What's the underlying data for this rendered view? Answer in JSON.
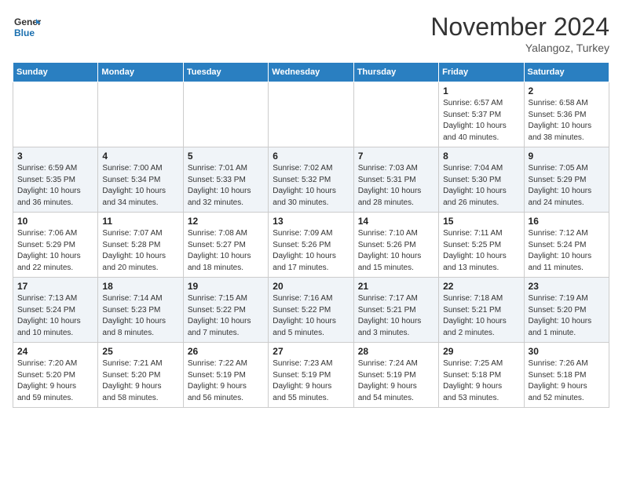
{
  "header": {
    "logo_line1": "General",
    "logo_line2": "Blue",
    "month": "November 2024",
    "location": "Yalangoz, Turkey"
  },
  "weekdays": [
    "Sunday",
    "Monday",
    "Tuesday",
    "Wednesday",
    "Thursday",
    "Friday",
    "Saturday"
  ],
  "weeks": [
    [
      {
        "day": "",
        "info": ""
      },
      {
        "day": "",
        "info": ""
      },
      {
        "day": "",
        "info": ""
      },
      {
        "day": "",
        "info": ""
      },
      {
        "day": "",
        "info": ""
      },
      {
        "day": "1",
        "info": "Sunrise: 6:57 AM\nSunset: 5:37 PM\nDaylight: 10 hours\nand 40 minutes."
      },
      {
        "day": "2",
        "info": "Sunrise: 6:58 AM\nSunset: 5:36 PM\nDaylight: 10 hours\nand 38 minutes."
      }
    ],
    [
      {
        "day": "3",
        "info": "Sunrise: 6:59 AM\nSunset: 5:35 PM\nDaylight: 10 hours\nand 36 minutes."
      },
      {
        "day": "4",
        "info": "Sunrise: 7:00 AM\nSunset: 5:34 PM\nDaylight: 10 hours\nand 34 minutes."
      },
      {
        "day": "5",
        "info": "Sunrise: 7:01 AM\nSunset: 5:33 PM\nDaylight: 10 hours\nand 32 minutes."
      },
      {
        "day": "6",
        "info": "Sunrise: 7:02 AM\nSunset: 5:32 PM\nDaylight: 10 hours\nand 30 minutes."
      },
      {
        "day": "7",
        "info": "Sunrise: 7:03 AM\nSunset: 5:31 PM\nDaylight: 10 hours\nand 28 minutes."
      },
      {
        "day": "8",
        "info": "Sunrise: 7:04 AM\nSunset: 5:30 PM\nDaylight: 10 hours\nand 26 minutes."
      },
      {
        "day": "9",
        "info": "Sunrise: 7:05 AM\nSunset: 5:29 PM\nDaylight: 10 hours\nand 24 minutes."
      }
    ],
    [
      {
        "day": "10",
        "info": "Sunrise: 7:06 AM\nSunset: 5:29 PM\nDaylight: 10 hours\nand 22 minutes."
      },
      {
        "day": "11",
        "info": "Sunrise: 7:07 AM\nSunset: 5:28 PM\nDaylight: 10 hours\nand 20 minutes."
      },
      {
        "day": "12",
        "info": "Sunrise: 7:08 AM\nSunset: 5:27 PM\nDaylight: 10 hours\nand 18 minutes."
      },
      {
        "day": "13",
        "info": "Sunrise: 7:09 AM\nSunset: 5:26 PM\nDaylight: 10 hours\nand 17 minutes."
      },
      {
        "day": "14",
        "info": "Sunrise: 7:10 AM\nSunset: 5:26 PM\nDaylight: 10 hours\nand 15 minutes."
      },
      {
        "day": "15",
        "info": "Sunrise: 7:11 AM\nSunset: 5:25 PM\nDaylight: 10 hours\nand 13 minutes."
      },
      {
        "day": "16",
        "info": "Sunrise: 7:12 AM\nSunset: 5:24 PM\nDaylight: 10 hours\nand 11 minutes."
      }
    ],
    [
      {
        "day": "17",
        "info": "Sunrise: 7:13 AM\nSunset: 5:24 PM\nDaylight: 10 hours\nand 10 minutes."
      },
      {
        "day": "18",
        "info": "Sunrise: 7:14 AM\nSunset: 5:23 PM\nDaylight: 10 hours\nand 8 minutes."
      },
      {
        "day": "19",
        "info": "Sunrise: 7:15 AM\nSunset: 5:22 PM\nDaylight: 10 hours\nand 7 minutes."
      },
      {
        "day": "20",
        "info": "Sunrise: 7:16 AM\nSunset: 5:22 PM\nDaylight: 10 hours\nand 5 minutes."
      },
      {
        "day": "21",
        "info": "Sunrise: 7:17 AM\nSunset: 5:21 PM\nDaylight: 10 hours\nand 3 minutes."
      },
      {
        "day": "22",
        "info": "Sunrise: 7:18 AM\nSunset: 5:21 PM\nDaylight: 10 hours\nand 2 minutes."
      },
      {
        "day": "23",
        "info": "Sunrise: 7:19 AM\nSunset: 5:20 PM\nDaylight: 10 hours\nand 1 minute."
      }
    ],
    [
      {
        "day": "24",
        "info": "Sunrise: 7:20 AM\nSunset: 5:20 PM\nDaylight: 9 hours\nand 59 minutes."
      },
      {
        "day": "25",
        "info": "Sunrise: 7:21 AM\nSunset: 5:20 PM\nDaylight: 9 hours\nand 58 minutes."
      },
      {
        "day": "26",
        "info": "Sunrise: 7:22 AM\nSunset: 5:19 PM\nDaylight: 9 hours\nand 56 minutes."
      },
      {
        "day": "27",
        "info": "Sunrise: 7:23 AM\nSunset: 5:19 PM\nDaylight: 9 hours\nand 55 minutes."
      },
      {
        "day": "28",
        "info": "Sunrise: 7:24 AM\nSunset: 5:19 PM\nDaylight: 9 hours\nand 54 minutes."
      },
      {
        "day": "29",
        "info": "Sunrise: 7:25 AM\nSunset: 5:18 PM\nDaylight: 9 hours\nand 53 minutes."
      },
      {
        "day": "30",
        "info": "Sunrise: 7:26 AM\nSunset: 5:18 PM\nDaylight: 9 hours\nand 52 minutes."
      }
    ]
  ]
}
